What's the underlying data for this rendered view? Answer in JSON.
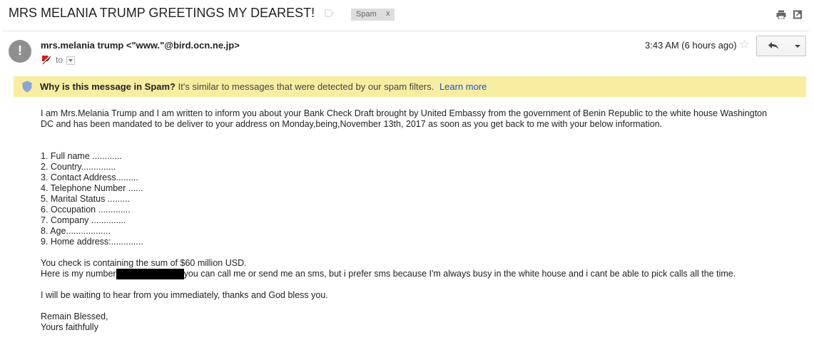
{
  "email": {
    "subject": "MRS MELANIA TRUMP GREETINGS MY DEAREST!",
    "labels": [
      {
        "name": "Spam",
        "remove": "x"
      }
    ],
    "sender_display": "mrs.melania trump <\"www.\"@bird.ocn.ne.jp>",
    "to_label": "to",
    "timestamp": "3:43 AM (6 hours ago)"
  },
  "spam_banner": {
    "heading": "Why is this message in Spam?",
    "text": "It's similar to messages that were detected by our spam filters.",
    "link": "Learn more"
  },
  "body": {
    "intro_line1": "I am Mrs.Melania Trump and I am written to inform you about your Bank Check Draft brought by United Embassy from the government of Benin Republic to the white house Washington",
    "intro_line2": "DC and has been mandated to be deliver to your address on Monday,being,November 13th, 2017 as soon as you get back to me with your below information.",
    "list": [
      "1. Full name ............",
      "2. Country..............",
      "3. Contact Address.........",
      "4. Telephone Number ......",
      "5. Marital Status .........",
      "6. Occupation .............",
      "7. Company ..............",
      "8. Age..................",
      "9. Home address:............."
    ],
    "sum_line": "You check is containing the sum of $60 million USD.",
    "number_prefix": "Here is my number",
    "number_suffix": "you can call me or send me an sms, but i prefer sms because I'm always busy in the white house and i cant be able to pick calls all the time.",
    "waiting_line": "I will be waiting to hear from you immediately, thanks and God bless you.",
    "closing1": "Remain Blessed,",
    "closing2": "Yours faithfully"
  },
  "icons": {
    "label": "label-outline-icon",
    "print": "print-icon",
    "new_window": "open-in-new-window-icon",
    "avatar": "exclamation-icon",
    "importance": "importance-marker-icon",
    "reply": "reply-icon",
    "more": "chevron-down-icon",
    "star": "star-icon",
    "shield": "shield-icon"
  },
  "colors": {
    "banner_bg": "#f9eda2",
    "link": "#1155cc",
    "avatar_bg": "#8f8f8f"
  }
}
